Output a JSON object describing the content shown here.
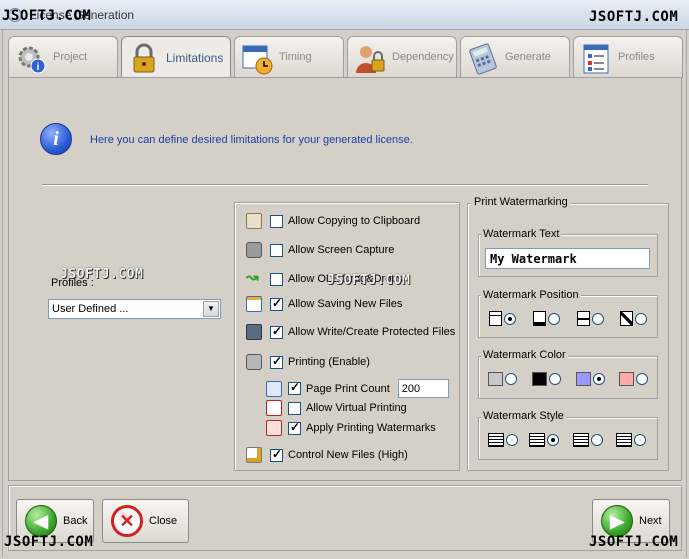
{
  "window": {
    "title": "License Generation"
  },
  "watermarks": {
    "top_left": "JSOFTJ.COM",
    "top_right": "JSOFTJ.COM",
    "mid_left": "JSOFTJ.COM",
    "mid_right": "JSOFTJ.COM",
    "bottom_left": "JSOFTJ.COM",
    "bottom_right": "JSOFTJ.COM"
  },
  "tabs": [
    {
      "label": "Project",
      "icon": "gear-info-icon",
      "active": false
    },
    {
      "label": "Limitations",
      "icon": "padlock-icon",
      "active": true
    },
    {
      "label": "Timing",
      "icon": "calendar-clock-icon",
      "active": false
    },
    {
      "label": "Dependency",
      "icon": "user-lock-icon",
      "active": false
    },
    {
      "label": "Generate",
      "icon": "calculator-icon",
      "active": false
    },
    {
      "label": "Profiles",
      "icon": "checklist-icon",
      "active": false
    }
  ],
  "info": {
    "text": "Here you can define desired limitations for your generated license."
  },
  "profiles": {
    "label": "Profiles :",
    "selected": "User Defined ..."
  },
  "options": {
    "copy_clipboard": {
      "label": "Allow Copying to Clipboard",
      "checked": false
    },
    "screen_capture": {
      "label": "Allow Screen Capture",
      "checked": false
    },
    "ole": {
      "label": "Allow OLE Drag&Drops",
      "checked": false
    },
    "save_new": {
      "label": "Allow Saving New Files",
      "checked": true
    },
    "write_protected": {
      "label": "Allow Write/Create Protected Files",
      "checked": true
    },
    "printing": {
      "label": "Printing (Enable)",
      "checked": true
    },
    "page_print_count": {
      "label": "Page Print Count",
      "checked": true,
      "value": "200"
    },
    "virtual_printing": {
      "label": "Allow Virtual Printing",
      "checked": false
    },
    "apply_watermarks": {
      "label": "Apply Printing Watermarks",
      "checked": true
    },
    "control_new_files": {
      "label": "Control New Files (High)",
      "checked": true
    }
  },
  "print_watermarking": {
    "title": "Print Watermarking",
    "text_group": {
      "title": "Watermark Text",
      "value": "My Watermark"
    },
    "position_group": {
      "title": "Watermark Position",
      "selected_index": 0
    },
    "color_group": {
      "title": "Watermark Color",
      "colors": [
        "#c8c8c8",
        "#000000",
        "#9999ff",
        "#ffaaaa"
      ],
      "selected_index": 2
    },
    "style_group": {
      "title": "Watermark Style",
      "selected_index": 1
    }
  },
  "buttons": {
    "back": "Back",
    "close": "Close",
    "next": "Next"
  }
}
